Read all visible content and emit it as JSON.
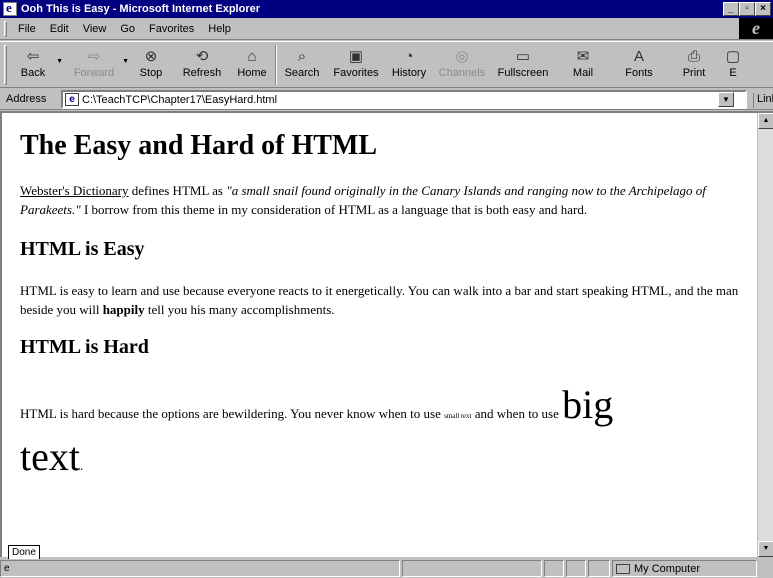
{
  "window": {
    "title": "Ooh This is Easy - Microsoft Internet Explorer"
  },
  "menu": {
    "items": [
      "File",
      "Edit",
      "View",
      "Go",
      "Favorites",
      "Help"
    ]
  },
  "toolbar": {
    "buttons": [
      {
        "label": "Back",
        "icon": "back-arrow-icon",
        "disabled": false
      },
      {
        "label": "Forward",
        "icon": "forward-arrow-icon",
        "disabled": true
      },
      {
        "label": "Stop",
        "icon": "stop-icon",
        "disabled": false
      },
      {
        "label": "Refresh",
        "icon": "refresh-icon",
        "disabled": false
      },
      {
        "label": "Home",
        "icon": "home-icon",
        "disabled": false
      },
      {
        "label": "Search",
        "icon": "search-icon",
        "disabled": false
      },
      {
        "label": "Favorites",
        "icon": "favorites-icon",
        "disabled": false
      },
      {
        "label": "History",
        "icon": "history-icon",
        "disabled": false
      },
      {
        "label": "Channels",
        "icon": "channels-icon",
        "disabled": true
      },
      {
        "label": "Fullscreen",
        "icon": "fullscreen-icon",
        "disabled": false
      },
      {
        "label": "Mail",
        "icon": "mail-icon",
        "disabled": false
      },
      {
        "label": "Fonts",
        "icon": "fonts-icon",
        "disabled": false
      },
      {
        "label": "Print",
        "icon": "print-icon",
        "disabled": false
      },
      {
        "label": "E",
        "icon": "edit-icon",
        "disabled": false
      }
    ]
  },
  "address": {
    "label": "Address",
    "value": "C:\\TeachTCP\\Chapter17\\EasyHard.html",
    "links_label": "Links"
  },
  "page": {
    "heading": "The Easy and Hard of HTML",
    "intro": {
      "link": "Webster's Dictionary",
      "text1": " defines HTML as ",
      "quote": "\"a small snail found originally in the Canary Islands and ranging now to the Archipelago of Parakeets.\"",
      "text2": " I borrow from this theme in my consideration of HTML as a language that is both easy and hard."
    },
    "easy_heading": "HTML is Easy",
    "easy_text": {
      "text1": "HTML is easy to learn and use because everyone reacts to it energetically. You can walk into a bar and start speaking HTML, and the man beside you will ",
      "bold": "happily",
      "text2": " tell you his many accomplishments."
    },
    "hard_heading": "HTML is Hard",
    "hard_text": {
      "text1": "HTML is hard because the options are bewildering. You never know when to use ",
      "small": "small text",
      "text2": " and when to use ",
      "big1": "big",
      "big2": "text",
      "end": "."
    }
  },
  "status": {
    "tooltip": "Done",
    "zone": "My Computer"
  }
}
